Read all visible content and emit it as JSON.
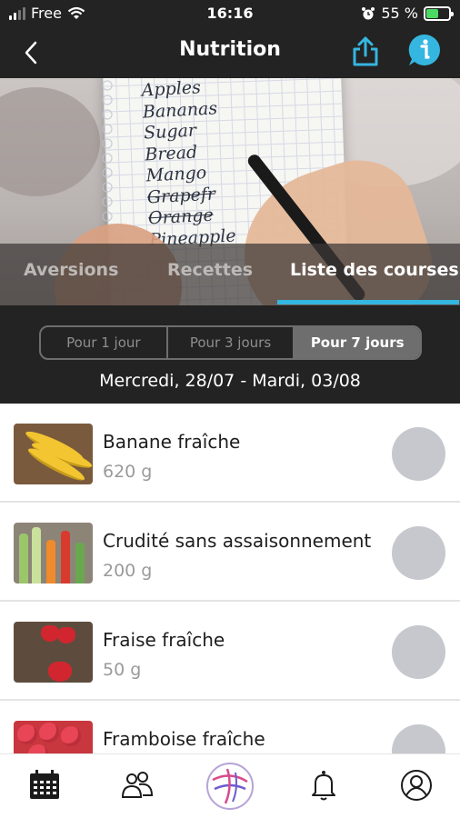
{
  "status_bar": {
    "carrier": "Free",
    "time": "16:16",
    "battery": "55 %"
  },
  "navbar": {
    "title": "Nutrition",
    "back_icon": "chevron-left-icon",
    "share_icon": "share-icon",
    "info_icon": "info-icon",
    "accent_color": "#35b6e0"
  },
  "hero": {
    "handwriting": [
      "Apples",
      "Bananas",
      "Sugar",
      "Bread",
      "Mango",
      "Grapefr",
      "Orange",
      "Pineapple"
    ]
  },
  "tabs": [
    {
      "label": "Aversions",
      "active": false
    },
    {
      "label": "Recettes",
      "active": false
    },
    {
      "label": "Liste des courses",
      "active": true
    }
  ],
  "segment": {
    "options": [
      "Pour 1 jour",
      "Pour 3 jours",
      "Pour 7 jours"
    ],
    "selected": "Pour 7 jours"
  },
  "date_range": "Mercredi, 28/07 - Mardi, 03/08",
  "items": [
    {
      "name": "Banane fraîche",
      "quantity": "620 g"
    },
    {
      "name": "Crudité sans assaisonnement",
      "quantity": "200 g"
    },
    {
      "name": "Fraise fraîche",
      "quantity": "50 g"
    },
    {
      "name": "Framboise fraîche",
      "quantity": ""
    }
  ],
  "tabbar": [
    {
      "icon": "calendar-icon",
      "active": true
    },
    {
      "icon": "community-icon",
      "active": false
    },
    {
      "icon": "app-logo-icon",
      "active": false
    },
    {
      "icon": "bell-icon",
      "active": false
    },
    {
      "icon": "profile-icon",
      "active": false
    }
  ]
}
